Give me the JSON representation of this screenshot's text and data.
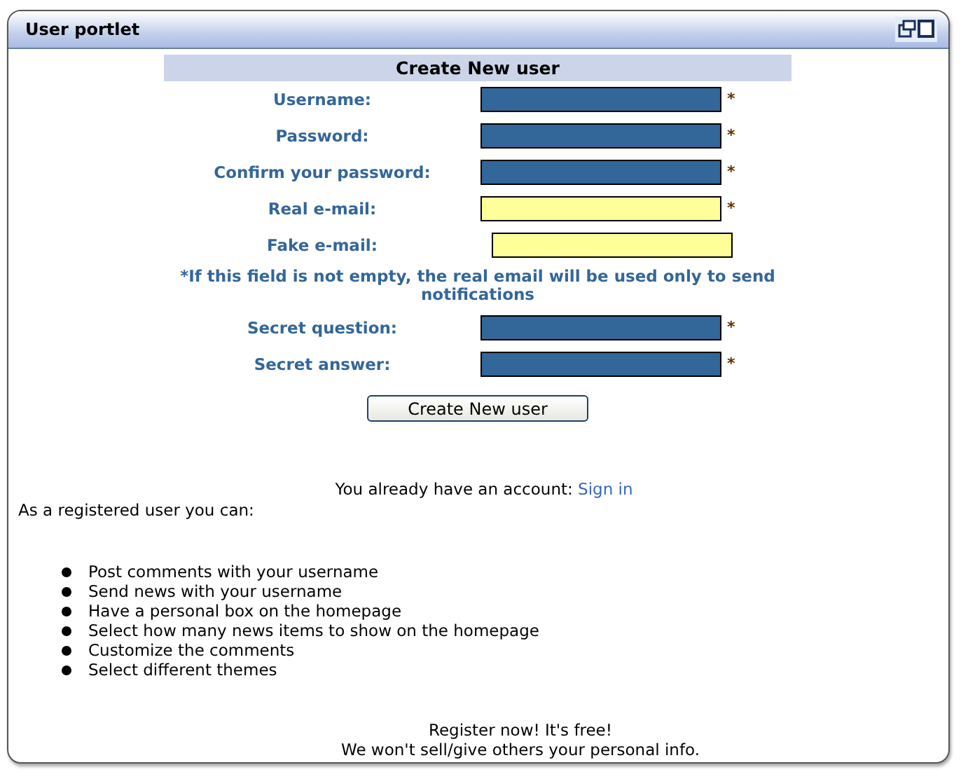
{
  "window": {
    "title": "User portlet"
  },
  "form": {
    "heading": "Create New user",
    "fields": [
      {
        "label": "Username:",
        "kind": "dark",
        "mark": "*"
      },
      {
        "label": "Password:",
        "kind": "dark",
        "mark": "*"
      },
      {
        "label": "Confirm your password:",
        "kind": "dark",
        "mark": "*"
      },
      {
        "label": "Real e-mail:",
        "kind": "light",
        "mark": "*"
      },
      {
        "label": "Fake e-mail:",
        "kind": "light"
      },
      {
        "kind": "note",
        "text": "*If this field is not empty, the real email will be used only to send notifications"
      },
      {
        "label": "Secret question:",
        "kind": "dark",
        "mark": "*"
      },
      {
        "label": "Secret answer:",
        "kind": "dark",
        "mark": "*"
      }
    ],
    "submit": "Create New user"
  },
  "signin": {
    "text": "You already have an account:",
    "link": "Sign in"
  },
  "benefits": {
    "intro": "As a registered user you can:",
    "items": [
      "Post comments with your username",
      "Send news with your username",
      "Have a personal box on the homepage",
      "Select how many news items to show on the homepage",
      "Customize the comments",
      "Select different themes"
    ]
  },
  "footer": [
    "Register now! It's free!",
    "We won't sell/give others your personal info."
  ]
}
